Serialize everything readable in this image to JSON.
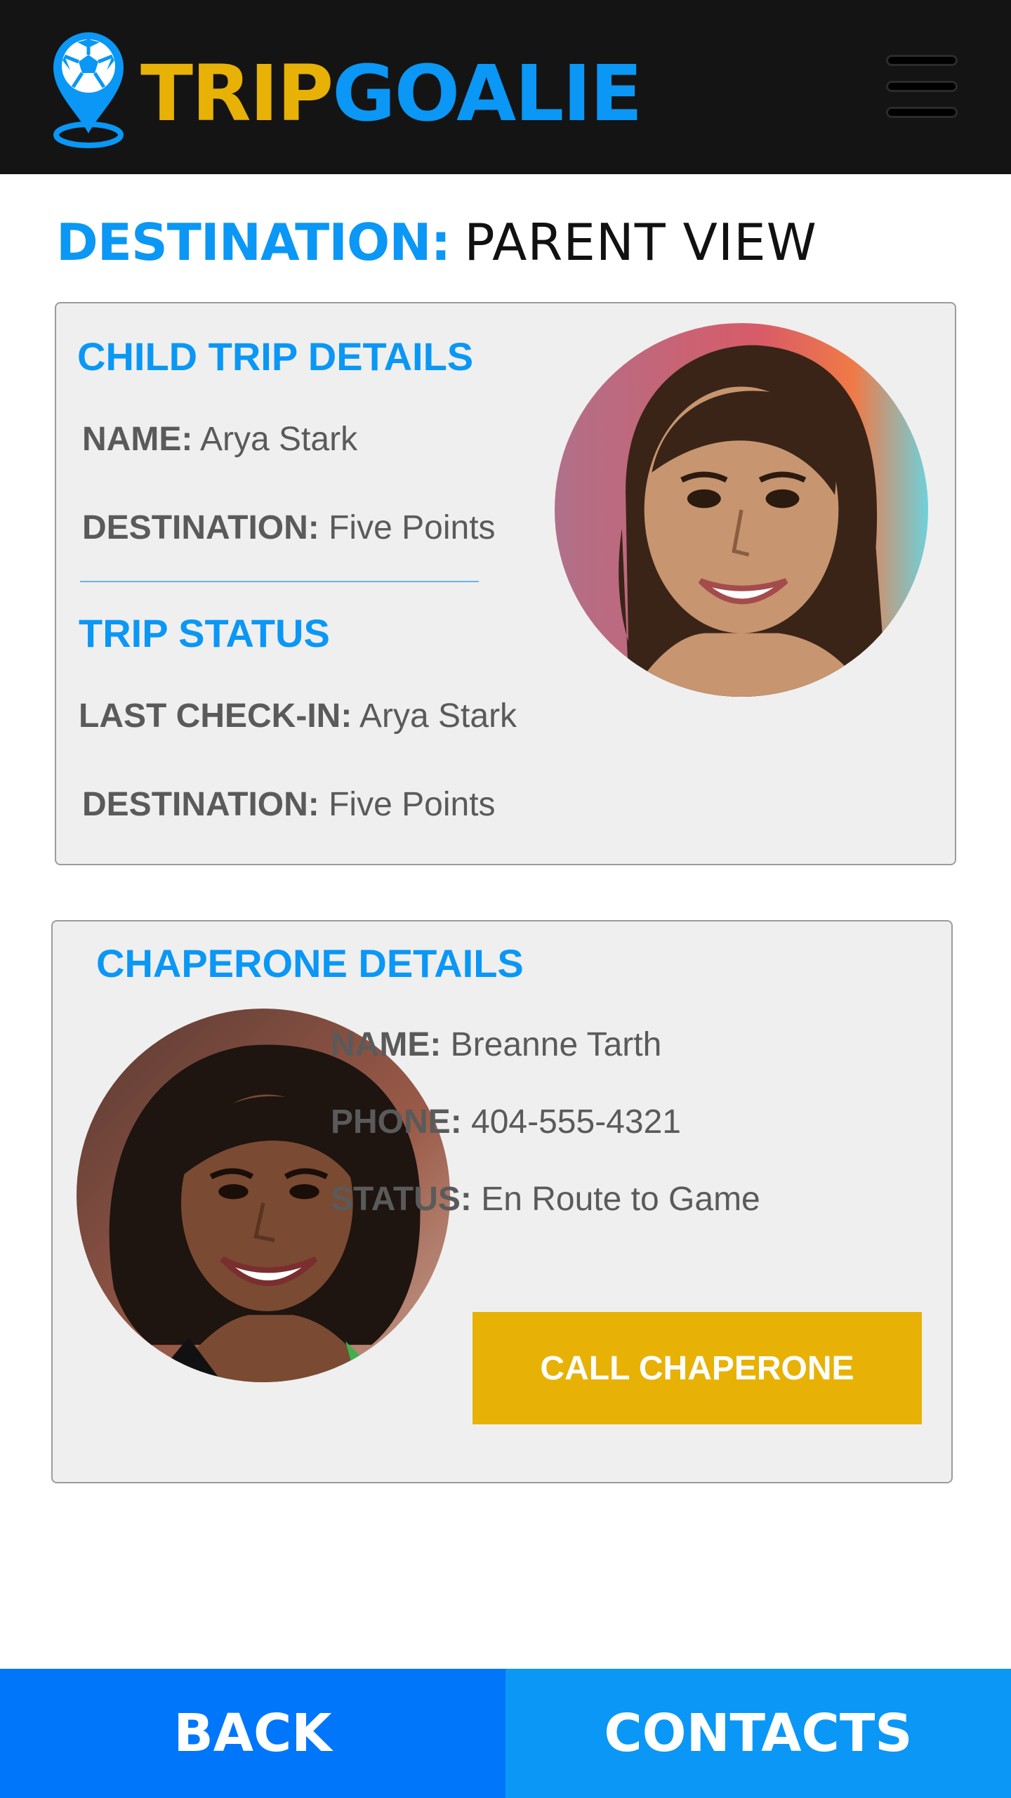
{
  "header": {
    "logo_part1": "TRIP",
    "logo_part2": "GOALIE",
    "brand_colors": {
      "trip": "#e8b106",
      "goalie": "#0a97f5",
      "bar": "#141414"
    },
    "logo_icon": "map-pin-soccer-ball-icon",
    "menu_icon": "hamburger-menu-icon"
  },
  "page_title": {
    "key": "DESTINATION:",
    "value": "PARENT VIEW"
  },
  "child_card": {
    "heading": "CHILD TRIP DETAILS",
    "name_label": "NAME:",
    "name_value": "Arya Stark",
    "destination_label": "DESTINATION:",
    "destination_value": "Five Points",
    "status_heading": "TRIP STATUS",
    "last_checkin_label": "LAST CHECK-IN:",
    "last_checkin_value": "Arya Stark",
    "status_destination_label": "DESTINATION:",
    "status_destination_value": "Five Points",
    "photo": "child-photo"
  },
  "chaperone_card": {
    "heading": "CHAPERONE DETAILS",
    "name_label": "NAME:",
    "name_value": "Breanne Tarth",
    "phone_label": "PHONE:",
    "phone_value": "404-555-4321",
    "status_label": "STATUS:",
    "status_value": "En Route to Game",
    "call_button": "CALL CHAPERONE",
    "photo": "chaperone-photo"
  },
  "bottom_nav": {
    "back": "BACK",
    "contacts": "CONTACTS"
  }
}
